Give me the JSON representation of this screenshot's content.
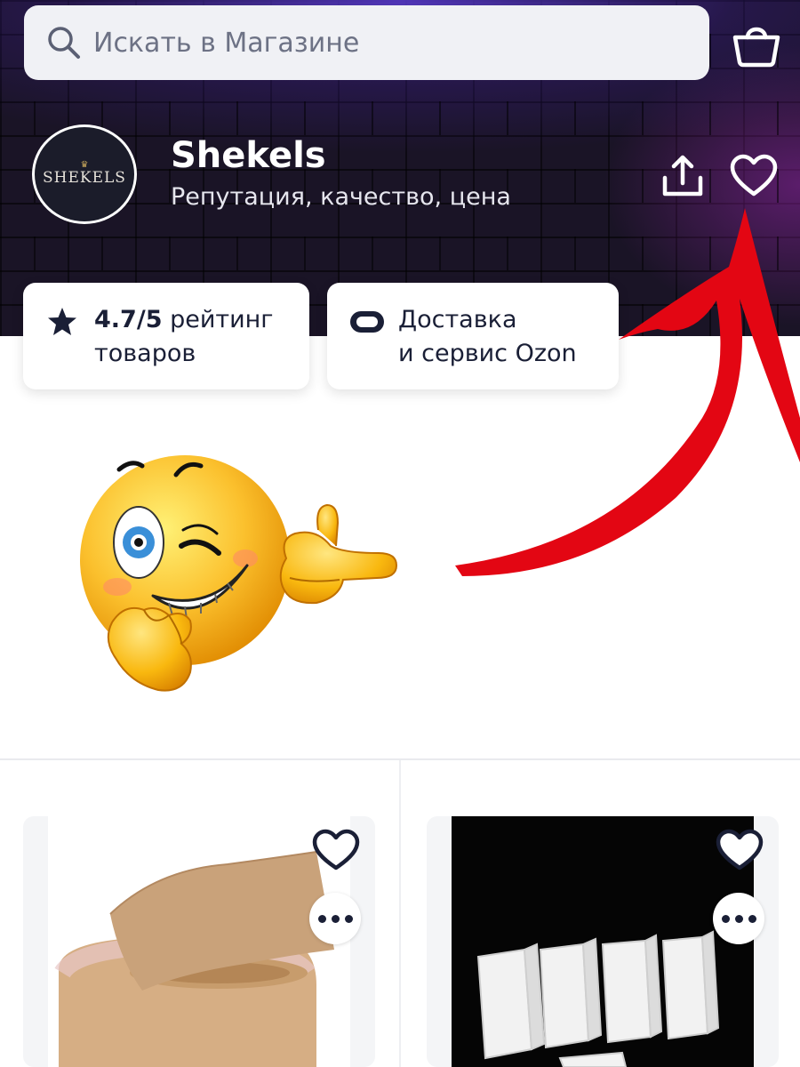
{
  "search": {
    "placeholder": "Искать в Магазине",
    "icon": "search-icon"
  },
  "header": {
    "cart_icon": "shopping-basket-icon",
    "share_icon": "share-icon",
    "favorite_icon": "heart-icon"
  },
  "store": {
    "logo_text": "SHEKELS",
    "name": "Shekels",
    "slogan": "Репутация, качество, цена"
  },
  "badges": {
    "rating": {
      "icon": "star-icon",
      "value": "4.7/5",
      "label_1": "рейтинг",
      "label_2": "товаров"
    },
    "delivery": {
      "icon": "ozon-logo-icon",
      "line_1": "Доставка",
      "line_2": "и сервис Ozon"
    }
  },
  "annotation": {
    "arrow_color": "#e30613",
    "emoji": "winking-pointing-emoji"
  },
  "products": [
    {
      "name": "kinesio-tape-product",
      "favorite_icon": "heart-icon",
      "more_icon": "more-dots-icon"
    },
    {
      "name": "sponge-blocks-product",
      "favorite_icon": "heart-icon",
      "more_icon": "more-dots-icon"
    }
  ],
  "colors": {
    "text_dark": "#1a1f36",
    "header_bg": "#1a1426",
    "search_bg": "#f0f1f5"
  }
}
